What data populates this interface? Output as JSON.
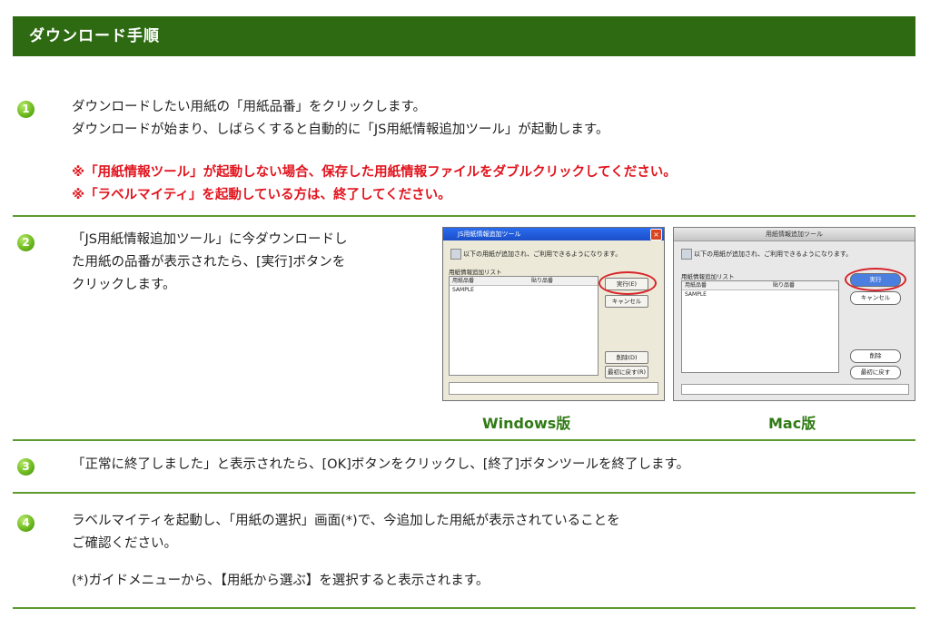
{
  "header": {
    "title": "ダウンロード手順"
  },
  "steps": [
    {
      "number": "1",
      "lines": [
        "ダウンロードしたい用紙の「用紙品番」をクリックします。",
        "ダウンロードが始まり、しばらくすると自動的に「JS用紙情報追加ツール」が起動します。"
      ],
      "notes": [
        "※「用紙情報ツール」が起動しない場合、保存した用紙情報ファイルをダブルクリックしてください。",
        "※「ラベルマイティ」を起動している方は、終了してください。"
      ]
    },
    {
      "number": "2",
      "lines": [
        "「JS用紙情報追加ツール」に今ダウンロードし",
        "た用紙の品番が表示されたら、[実行]ボタンを",
        "クリックします。"
      ],
      "windows_caption": "Windows版",
      "mac_caption": "Mac版"
    },
    {
      "number": "3",
      "lines": [
        "「正常に終了しました」と表示されたら、[OK]ボタンをクリックし、[終了]ボタンツールを終了します。"
      ]
    },
    {
      "number": "4",
      "lines": [
        "ラベルマイティを起動し、「用紙の選択」画面(*)で、今追加した用紙が表示されていることを",
        "ご確認ください。"
      ],
      "footnote": "(*)ガイドメニューから、【用紙から選ぶ】を選択すると表示されます。"
    }
  ],
  "win_dialog": {
    "title": "JS用紙情報追加ツール",
    "message": "以下の用紙が追加され、ご利用できるようになります。",
    "list_label": "用紙情報追加リスト",
    "col1": "用紙品番",
    "col2": "貼り品番",
    "row": "SAMPLE",
    "run": "実行(E)",
    "cancel": "キャンセル",
    "delete": "削除(D)",
    "restore": "最初に戻す(R)"
  },
  "mac_dialog": {
    "title": "用紙情報追加ツール",
    "message": "以下の用紙が追加され、ご利用できるようになります。",
    "list_label": "用紙情報追加リスト",
    "col1": "用紙品番",
    "col2": "貼り品番",
    "row": "SAMPLE",
    "run": "実行",
    "cancel": "キャンセル",
    "delete": "削除",
    "restore": "最初に戻す"
  }
}
